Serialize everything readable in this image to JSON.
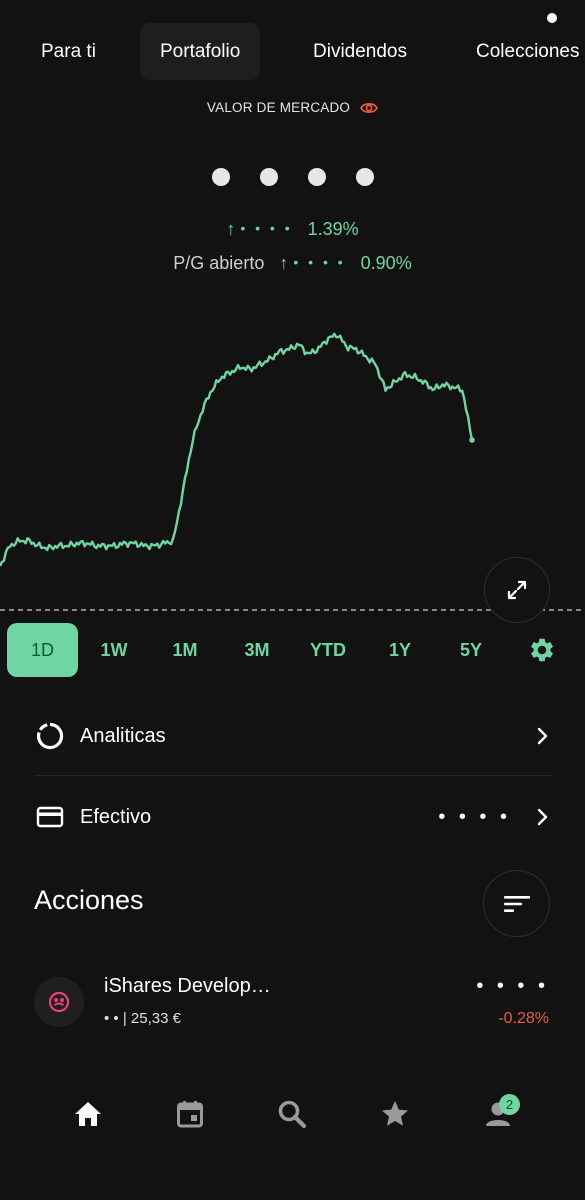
{
  "tabs": {
    "para_ti": "Para ti",
    "portafolio": "Portafolio",
    "dividendos": "Dividendos",
    "colecciones": "Colecciones"
  },
  "header": {
    "market_value_label": "VALOR DE MERCADO",
    "hidden_value_icon": "dots-hidden",
    "change_arrow": "↑",
    "change_masked": "• • • •",
    "change_pct": "1.39%",
    "pl_label": "P/G abierto",
    "pl_arrow": "↑",
    "pl_masked": "• • • •",
    "pl_pct": "0.90%"
  },
  "chart_data": {
    "type": "line",
    "title": "",
    "xlabel": "",
    "ylabel": "",
    "color": "#6fd6a3",
    "y": [
      0.0,
      0.08,
      0.1,
      0.1,
      0.08,
      0.07,
      0.08,
      0.08,
      0.09,
      0.09,
      0.08,
      0.08,
      0.08,
      0.09,
      0.09,
      0.08,
      0.08,
      0.09,
      0.1,
      0.3,
      0.5,
      0.62,
      0.7,
      0.75,
      0.77,
      0.79,
      0.78,
      0.8,
      0.82,
      0.85,
      0.86,
      0.88,
      0.84,
      0.86,
      0.9,
      0.92,
      0.87,
      0.86,
      0.83,
      0.8,
      0.7,
      0.73,
      0.76,
      0.75,
      0.73,
      0.7,
      0.72,
      0.71,
      0.7,
      0.5
    ]
  },
  "ranges": {
    "r1d": "1D",
    "r1w": "1W",
    "r1m": "1M",
    "r3m": "3M",
    "rytd": "YTD",
    "r1y": "1Y",
    "r5y": "5Y"
  },
  "menu": {
    "analytics_label": "Analiticas",
    "cash_label": "Efectivo",
    "cash_value": "• • • •"
  },
  "holdings_section": {
    "title": "Acciones"
  },
  "holding": {
    "name": "iShares Develop…",
    "sub": "• • | 25,33 €",
    "value": "• • • •",
    "change": "-0.28%"
  },
  "nav": {
    "profile_badge": "2"
  },
  "colors": {
    "accent": "#6fd6a3",
    "negative": "#e85b44",
    "background": "#121212"
  }
}
